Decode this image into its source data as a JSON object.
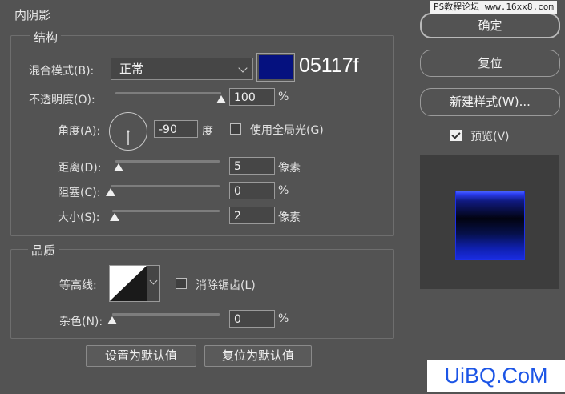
{
  "dialog": {
    "title": "内阴影"
  },
  "structure": {
    "title": "结构",
    "blend_mode": {
      "label": "混合模式(B):",
      "value": "正常",
      "color_hex": "05117f",
      "color_swatch": "#05117f"
    },
    "opacity": {
      "label": "不透明度(O):",
      "value": "100",
      "unit": "%",
      "slider_fraction": 1.0
    },
    "angle": {
      "label": "角度(A):",
      "value": "-90",
      "unit": "度",
      "global_light_label": "使用全局光(G)",
      "global_light_checked": false,
      "dial_degrees": -90
    },
    "distance": {
      "label": "距离(D):",
      "value": "5",
      "unit": "像素",
      "slider_fraction": 0.03
    },
    "choke": {
      "label": "阻塞(C):",
      "value": "0",
      "unit": "%",
      "slider_fraction": 0.0
    },
    "size": {
      "label": "大小(S):",
      "value": "2",
      "unit": "像素",
      "slider_fraction": 0.02
    }
  },
  "quality": {
    "title": "品质",
    "contour": {
      "label": "等高线:",
      "anti_alias_label": "消除锯齿(L)",
      "anti_alias_checked": false
    },
    "noise": {
      "label": "杂色(N):",
      "value": "0",
      "unit": "%",
      "slider_fraction": 0.0
    }
  },
  "footer": {
    "reset_label": "设置为默认值",
    "restore_label": "复位为默认值"
  },
  "side": {
    "ok_label": "确定",
    "reset_label": "复位",
    "new_style_label": "新建样式(W)...",
    "preview_label": "预览(V)",
    "preview_checked": true
  },
  "watermarks": {
    "top_right": "PS教程论坛 www.16xx8.com",
    "bottom_right": "UiBQ.CoM"
  },
  "colors": {
    "bg": "#535353",
    "preview_box": "#3d3d3d",
    "preview_blue": "#1326d8"
  }
}
